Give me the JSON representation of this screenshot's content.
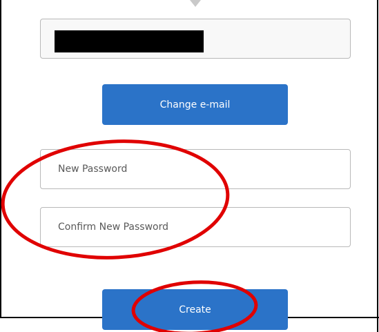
{
  "form": {
    "email_field": {
      "value_redacted": true
    },
    "change_email_label": "Change e-mail",
    "new_password_placeholder": "New Password",
    "confirm_password_placeholder": "Confirm New Password",
    "create_label": "Create"
  },
  "colors": {
    "primary_button": "#2b73c8",
    "annotation_circle": "#e00000",
    "field_border": "#b8b8b8"
  },
  "annotations": [
    {
      "target": "password-fields",
      "shape": "ellipse",
      "color": "red"
    },
    {
      "target": "create-button",
      "shape": "ellipse",
      "color": "red"
    }
  ]
}
